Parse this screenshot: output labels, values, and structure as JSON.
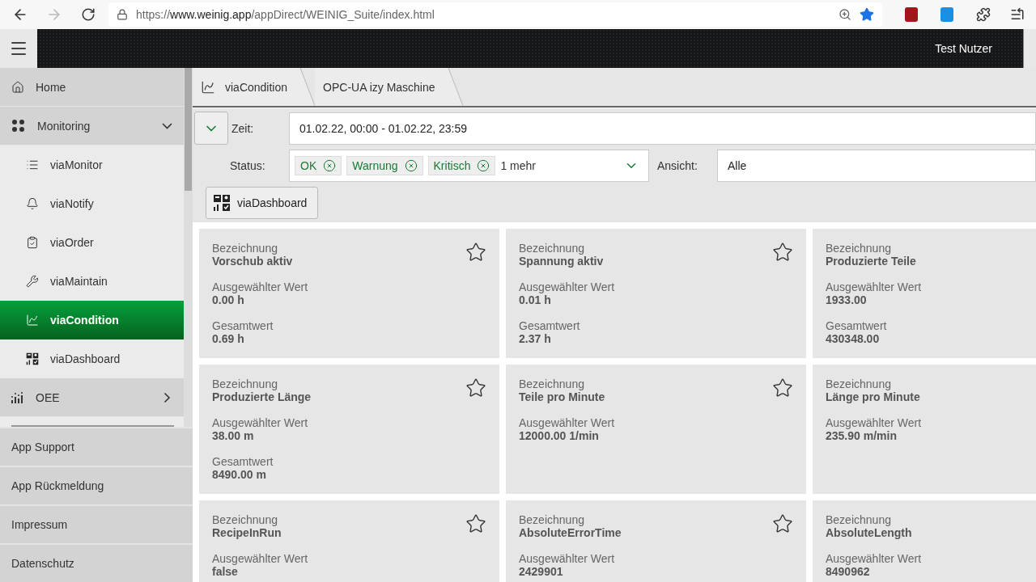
{
  "browser": {
    "url_prefix": "https://",
    "url_host": "www.weinig.app",
    "url_path": "/appDirect/WEINIG_Suite/index.html",
    "bookmarked": true
  },
  "header": {
    "user": "Test Nutzer"
  },
  "sidebar": {
    "items": [
      {
        "kind": "nav",
        "label": "Home",
        "selected": false
      },
      {
        "kind": "group",
        "label": "Monitoring",
        "expanded": true,
        "children": [
          {
            "label": "viaMonitor",
            "selected": false
          },
          {
            "label": "viaNotify",
            "selected": false
          },
          {
            "label": "viaOrder",
            "selected": false
          },
          {
            "label": "viaMaintain",
            "selected": false
          },
          {
            "label": "viaCondition",
            "selected": true
          },
          {
            "label": "viaDashboard",
            "selected": false
          }
        ]
      },
      {
        "kind": "group",
        "label": "OEE",
        "expanded": false
      }
    ],
    "links": [
      "App Support",
      "App Rückmeldung",
      "Impressum",
      "Datenschutz"
    ]
  },
  "breadcrumb": [
    "viaCondition",
    "OPC-UA izy Maschine"
  ],
  "filters": {
    "expanded": true,
    "time_label": "Zeit:",
    "time_value": "01.02.22, 00:00 - 01.02.22, 23:59",
    "status_label": "Status:",
    "status_tags": [
      "OK",
      "Warnung",
      "Kritisch"
    ],
    "status_more": "1 mehr",
    "view_label": "Ansicht:",
    "view_value": "Alle"
  },
  "dashboard_button": "viaDashboard",
  "cards": [
    {
      "favorite": false,
      "fields": [
        {
          "label": "Bezeichnung",
          "value": "Vorschub aktiv"
        },
        {
          "label": "Ausgewählter Wert",
          "value": "0.00 h"
        },
        {
          "label": "Gesamtwert",
          "value": "0.69 h"
        }
      ]
    },
    {
      "favorite": false,
      "fields": [
        {
          "label": "Bezeichnung",
          "value": "Spannung aktiv"
        },
        {
          "label": "Ausgewählter Wert",
          "value": "0.01 h"
        },
        {
          "label": "Gesamtwert",
          "value": "2.37 h"
        }
      ]
    },
    {
      "fields": [
        {
          "label": "Bezeichnung",
          "value": "Produzierte Teile"
        },
        {
          "label": "Ausgewählter Wert",
          "value": "1933.00"
        },
        {
          "label": "Gesamtwert",
          "value": "430348.00"
        }
      ]
    },
    {
      "favorite": false,
      "fields": [
        {
          "label": "Bezeichnung",
          "value": "Produzierte Länge"
        },
        {
          "label": "Ausgewählter Wert",
          "value": "38.00 m"
        },
        {
          "label": "Gesamtwert",
          "value": "8490.00 m"
        }
      ]
    },
    {
      "favorite": false,
      "fields": [
        {
          "label": "Bezeichnung",
          "value": "Teile pro Minute"
        },
        {
          "label": "Ausgewählter Wert",
          "value": "12000.00 1/min"
        }
      ]
    },
    {
      "fields": [
        {
          "label": "Bezeichnung",
          "value": "Länge pro Minute"
        },
        {
          "label": "Ausgewählter Wert",
          "value": "235.90 m/min"
        }
      ]
    },
    {
      "favorite": false,
      "fields": [
        {
          "label": "Bezeichnung",
          "value": "RecipeInRun"
        },
        {
          "label": "Ausgewählter Wert",
          "value": "false"
        }
      ]
    },
    {
      "favorite": false,
      "fields": [
        {
          "label": "Bezeichnung",
          "value": "AbsoluteErrorTime"
        },
        {
          "label": "Ausgewählter Wert",
          "value": "2429901"
        }
      ]
    },
    {
      "fields": [
        {
          "label": "Bezeichnung",
          "value": "AbsoluteLength"
        },
        {
          "label": "Ausgewählter Wert",
          "value": "8490962"
        }
      ]
    }
  ]
}
